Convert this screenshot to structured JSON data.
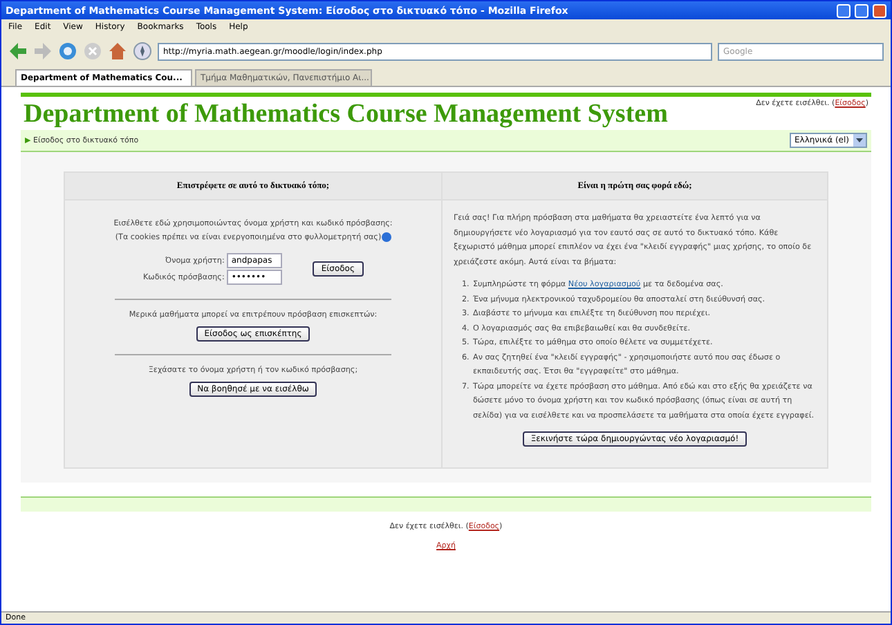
{
  "window": {
    "title": "Department of Mathematics Course Management System: Είσοδος στο δικτυακό τόπο - Mozilla Firefox"
  },
  "menu": [
    "File",
    "Edit",
    "View",
    "History",
    "Bookmarks",
    "Tools",
    "Help"
  ],
  "address": {
    "value": "http://myria.math.aegean.gr/moodle/login/index.php"
  },
  "search": {
    "placeholder": "Google"
  },
  "tabs": [
    {
      "label": "Department of Mathematics Cou...",
      "selected": true
    },
    {
      "label": "Τμήμα Μαθηματικών, Πανεπιστήμιο Αι...",
      "selected": false
    }
  ],
  "header": {
    "title": "Department of Mathematics Course Management System",
    "login_info": "Δεν έχετε εισέλθει. (",
    "login_link": "Είσοδος",
    "login_close": ")"
  },
  "breadcrumb": {
    "arrow": "▶",
    "label": "Είσοδος στο δικτυακό τόπο"
  },
  "language": {
    "value": "Ελληνικά (el)"
  },
  "left_panel": {
    "heading": "Επιστρέφετε σε αυτό το δικτυακό τόπο;",
    "intro": "Εισέλθετε εδώ χρησιμοποιώντας όνομα χρήστη και κωδικό πρόσβασης:",
    "cookies_note": "(Τα cookies πρέπει να είναι ενεργοποιημένα στο φυλλομετρητή σας)",
    "username_label": "Όνομα χρήστη:",
    "username_value": "andpapas",
    "password_label": "Κωδικός πρόσβασης:",
    "password_value": "•••••••",
    "login_button": "Είσοδος",
    "guest_note": "Μερικά μαθήματα μπορεί να επιτρέπουν πρόσβαση επισκεπτών:",
    "guest_button": "Είσοδος ως επισκέπτης",
    "forgot_note": "Ξεχάσατε το όνομα χρήστη ή τον κωδικό πρόσβασης;",
    "forgot_button": "Να βοηθησέ με να εισέλθω"
  },
  "right_panel": {
    "heading": "Είναι η πρώτη σας φορά εδώ;",
    "paragraph": "Γειά σας! Για πλήρη πρόσβαση στα μαθήματα θα χρειαστείτε ένα λεπτό για να δημιουργήσετε νέο λογαριασμό για τον εαυτό σας σε αυτό το δικτυακό τόπο. Κάθε ξεχωριστό μάθημα μπορεί επιπλέον να έχει ένα \"κλειδί εγγραφής\" μιας χρήσης, το οποίο δε χρειάζεστε ακόμη. Αυτά είναι τα βήματα:",
    "steps": [
      {
        "number": "1.",
        "text": "Συμπληρώστε τη φόρμα ",
        "link": "Νέου λογαριασμού",
        "after": " με τα δεδομένα σας."
      },
      {
        "number": "2.",
        "text": "Ένα μήνυμα ηλεκτρονικού ταχυδρομείου θα αποσταλεί στη διεύθυνσή σας."
      },
      {
        "number": "3.",
        "text": "Διαβάστε το μήνυμα και επιλέξτε τη διεύθυνση που περιέχει."
      },
      {
        "number": "4.",
        "text": "Ο λογαριασμός σας θα επιβεβαιωθεί και θα συνδεθείτε."
      },
      {
        "number": "5.",
        "text": "Τώρα, επιλέξτε το μάθημα στο οποίο θέλετε να συμμετέχετε."
      },
      {
        "number": "6.",
        "text": "Αν σας ζητηθεί ένα \"κλειδί εγγραφής\" - χρησιμοποιήστε αυτό που σας έδωσε ο εκπαιδευτής σας. Έτσι θα \"εγγραφείτε\" στο μάθημα."
      },
      {
        "number": "7.",
        "text": "Τώρα μπορείτε να έχετε πρόσβαση στο μάθημα. Από εδώ και στο εξής θα χρειάζετε να δώσετε μόνο το όνομα χρήστη και τον κωδικό πρόσβασης (όπως είναι σε αυτή τη σελίδα) για να εισέλθετε και να προσπελάσετε τα μαθήματα στα οποία έχετε εγγραφεί."
      }
    ],
    "signup_button": "Ξεκινήστε τώρα δημιουργώντας νέο λογαριασμό!"
  },
  "footer": {
    "login_info": "Δεν έχετε εισέλθει. (",
    "login_link": "Είσοδος",
    "login_close": ")",
    "home_link": "Αρχή"
  },
  "status_bar": {
    "text": "Done"
  }
}
